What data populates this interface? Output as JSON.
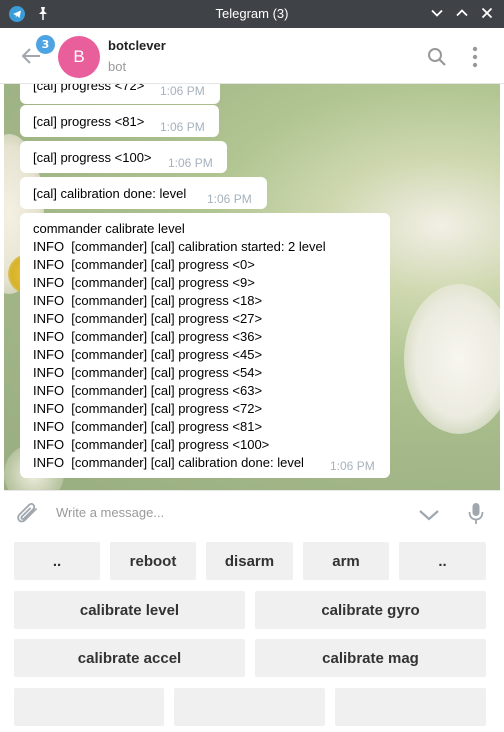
{
  "window": {
    "title": "Telegram (3)"
  },
  "header": {
    "unread_count": "3",
    "avatar_letter": "B",
    "peer_name": "botclever",
    "peer_status": "bot"
  },
  "messages": [
    {
      "text": "[cal] progress <72>",
      "time": "1:06 PM"
    },
    {
      "text": "[cal] progress <81>",
      "time": "1:06 PM"
    },
    {
      "text": "[cal] progress <100>",
      "time": "1:06 PM"
    },
    {
      "text": "[cal] calibration done: level",
      "time": "1:06 PM"
    },
    {
      "lines": [
        "commander calibrate level",
        "INFO  [commander] [cal] calibration started: 2 level",
        "INFO  [commander] [cal] progress <0>",
        "INFO  [commander] [cal] progress <9>",
        "INFO  [commander] [cal] progress <18>",
        "INFO  [commander] [cal] progress <27>",
        "INFO  [commander] [cal] progress <36>",
        "INFO  [commander] [cal] progress <45>",
        "INFO  [commander] [cal] progress <54>",
        "INFO  [commander] [cal] progress <63>",
        "INFO  [commander] [cal] progress <72>",
        "INFO  [commander] [cal] progress <81>",
        "INFO  [commander] [cal] progress <100>",
        "INFO  [commander] [cal] calibration done: level"
      ],
      "time": "1:06 PM"
    }
  ],
  "input": {
    "placeholder": "Write a message..."
  },
  "keyboard": {
    "row1": [
      "..",
      "reboot",
      "disarm",
      "arm",
      ".."
    ],
    "row2": [
      "calibrate level",
      "calibrate gyro"
    ],
    "row3": [
      "calibrate accel",
      "calibrate mag"
    ],
    "row4": [
      "",
      "",
      ""
    ]
  },
  "colors": {
    "titlebar": "#3f4347",
    "accent": "#4ea4e3",
    "avatar": "#e85f9c",
    "time_text": "#a5b2bd"
  },
  "icons": [
    "telegram-logo-icon",
    "pin-icon",
    "minimize-icon",
    "maximize-icon",
    "close-icon",
    "back-arrow-icon",
    "search-icon",
    "more-vertical-icon",
    "paperclip-icon",
    "chevron-down-icon",
    "microphone-icon"
  ]
}
